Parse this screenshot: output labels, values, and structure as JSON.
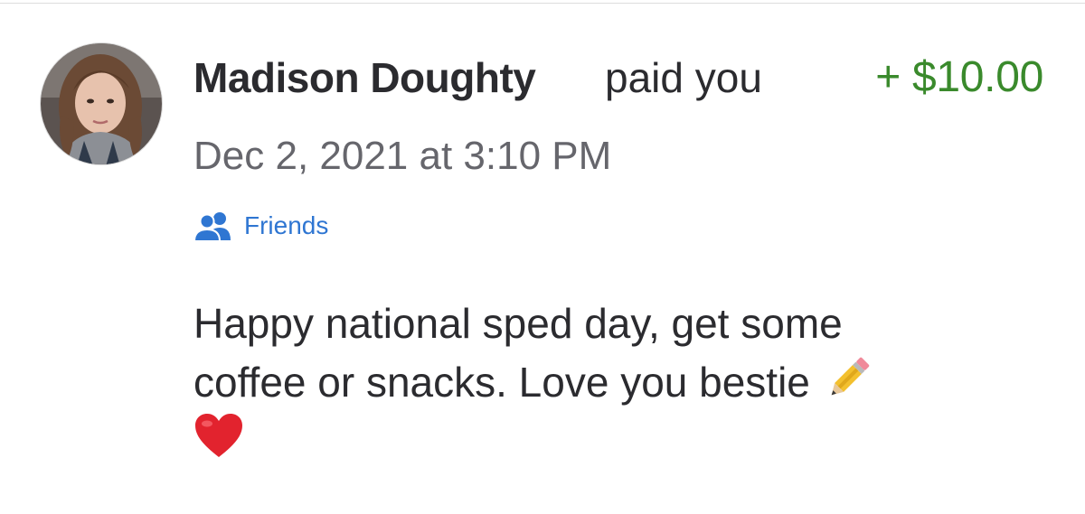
{
  "transaction": {
    "payer_name": "Madison Doughty",
    "action": "paid you",
    "amount": "+ $10.00",
    "timestamp": "Dec 2, 2021 at 3:10 PM",
    "privacy_icon": "friends-icon",
    "privacy_label": "Friends",
    "note_lines": [
      "Happy national sped day, get some",
      "coffee or snacks. Love you bestie"
    ],
    "note_emojis": [
      "pencil",
      "red-heart"
    ]
  },
  "colors": {
    "text_primary": "#2b2b2f",
    "text_secondary": "#66666c",
    "amount_positive": "#3a8a2c",
    "link_blue": "#2f76d2"
  }
}
